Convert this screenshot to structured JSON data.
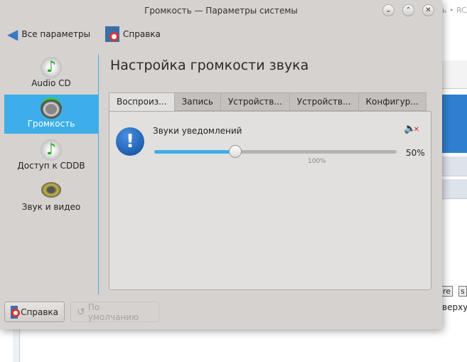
{
  "window": {
    "title": "Громкость — Параметры системы"
  },
  "background": {
    "title_fragment": "ь • RC",
    "text1": "re",
    "text2": "s",
    "text3": "верху"
  },
  "toolbar": {
    "back_label": "Все параметры",
    "help_label": "Справка"
  },
  "sidebar": {
    "items": [
      {
        "label": "Audio CD",
        "icon": "audio-cd-icon",
        "selected": false
      },
      {
        "label": "Громкость",
        "icon": "volume-speaker-icon",
        "selected": true
      },
      {
        "label": "Доступ к CDDB",
        "icon": "cddb-icon",
        "selected": false
      },
      {
        "label": "Звук и видео",
        "icon": "sound-video-icon",
        "selected": false
      }
    ]
  },
  "main": {
    "heading": "Настройка громкости звука",
    "tabs": [
      {
        "label": "Воспроиз...",
        "active": true
      },
      {
        "label": "Запись"
      },
      {
        "label": "Устройств..."
      },
      {
        "label": "Устройств..."
      },
      {
        "label": "Конфигур..."
      }
    ],
    "stream": {
      "name": "Звуки уведомлений",
      "volume_percent": "50%",
      "volume": 50,
      "max_mark": "100%",
      "muted": false
    }
  },
  "footer": {
    "help_label": "Справка",
    "defaults_label": "По умолчанию"
  },
  "colors": {
    "accent": "#3daee9",
    "window": "#d6d2d0"
  }
}
